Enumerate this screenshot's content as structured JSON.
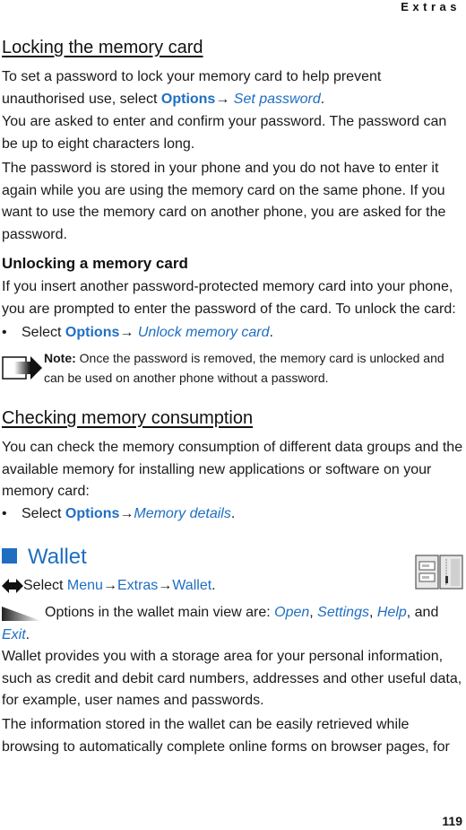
{
  "header": {
    "section": "Extras"
  },
  "locking": {
    "title": "Locking the memory card",
    "p1_pre": "To set a password to lock your memory card to help prevent unauthorised use, select ",
    "p1_opt": "Options",
    "p1_arrow": "→ ",
    "p1_cmd": "Set password",
    "p1_end": ".",
    "p2": "You are asked to enter and confirm your password. The password can be up to eight characters long.",
    "p3": "The password is stored in your phone and you do not have to enter it again while you are using the memory card on the same phone. If you want to use the memory card on another phone, you are asked for the password."
  },
  "unlocking": {
    "title": "Unlocking a memory card",
    "p1": "If you insert another password-protected memory card into your phone, you are prompted to enter the password of the card. To unlock the card:",
    "bullet_pre": "Select ",
    "bullet_opt": "Options",
    "bullet_arrow": "→ ",
    "bullet_cmd": "Unlock memory card",
    "bullet_end": ".",
    "note_label": "Note:",
    "note_text": " Once the password is removed, the memory card is unlocked and can be used on another phone without a password."
  },
  "checking": {
    "title": "Checking memory consumption",
    "p1": "You can check the memory consumption of different data groups and the available memory for installing new applications or software on your memory card:",
    "bullet_pre": "Select ",
    "bullet_opt": "Options",
    "bullet_arrow": "→",
    "bullet_cmd": "Memory details",
    "bullet_end": "."
  },
  "wallet": {
    "title": "Wallet",
    "select_pre": "Select ",
    "menu": "Menu",
    "arrow1": "→",
    "extras": "Extras",
    "arrow2": "→",
    "wallet_cmd": "Wallet",
    "select_end": ".",
    "options_pre": "Options in the wallet main view are: ",
    "opt_open": "Open",
    "sep1": ", ",
    "opt_settings": "Settings",
    "sep2": ", ",
    "opt_help": "Help",
    "sep3": ", and ",
    "opt_exit": "Exit",
    "options_end": ".",
    "p1": "Wallet provides you with a storage area for your personal information, such as credit and debit card numbers, addresses and other useful data, for example, user names and passwords.",
    "p2": "The information stored in the wallet can be easily retrieved while browsing to automatically complete online forms on browser pages, for"
  },
  "footer": {
    "page_number": "119"
  }
}
